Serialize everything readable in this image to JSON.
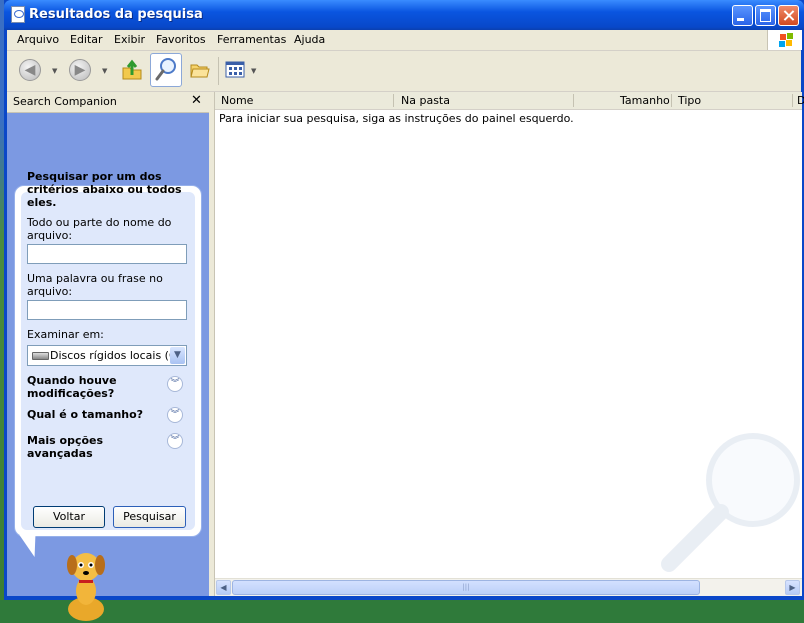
{
  "window": {
    "title": "Resultados da pesquisa"
  },
  "menu": {
    "items": [
      "Arquivo",
      "Editar",
      "Exibir",
      "Favoritos",
      "Ferramentas",
      "Ajuda"
    ]
  },
  "toolbar": {
    "back_icon": "back-arrow-icon",
    "forward_icon": "forward-arrow-icon",
    "up_icon": "folder-up-icon",
    "search_icon": "magnifier-icon",
    "folders_icon": "folders-icon",
    "views_icon": "views-icon"
  },
  "companion": {
    "title": "Search Companion",
    "close": "✕",
    "heading": "Pesquisar por um dos critérios abaixo ou todos eles.",
    "filename_label": "Todo ou parte do nome do arquivo:",
    "filename_value": "",
    "phrase_label": "Uma palavra ou frase no arquivo:",
    "phrase_value": "",
    "lookin_label": "Examinar em:",
    "lookin_value": "Discos rígidos locais (C:)",
    "adv1": "Quando houve modificações?",
    "adv2": "Qual é o tamanho?",
    "adv3": "Mais opções avançadas",
    "back_button": "Voltar",
    "search_button": "Pesquisar"
  },
  "results": {
    "columns": [
      "Nome",
      "Na pasta",
      "Tamanho",
      "Tipo",
      "D"
    ],
    "message": "Para iniciar sua pesquisa, siga as instruções do painel esquerdo."
  },
  "colors": {
    "title_bar": "#0a55e0",
    "companion_bg": "#7c99e2",
    "bubble_bg": "#dfe8fb"
  }
}
